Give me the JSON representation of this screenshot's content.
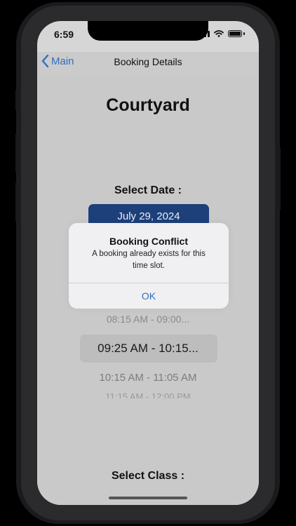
{
  "status_bar": {
    "time": "6:59"
  },
  "nav": {
    "back_label": "Main",
    "title": "Booking Details"
  },
  "venue": {
    "name": "Courtyard"
  },
  "date": {
    "label": "Select Date :",
    "value": "July 29, 2024"
  },
  "time_slots": [
    {
      "text": "08:15 AM - 09:00...",
      "selected": false
    },
    {
      "text": "09:25 AM - 10:15...",
      "selected": true
    },
    {
      "text": "10:15 AM - 11:05 AM",
      "selected": false
    },
    {
      "text": "11:15 AM - 12:00 PM",
      "selected": false
    }
  ],
  "class": {
    "label": "Select Class :"
  },
  "alert": {
    "title": "Booking Conflict",
    "message": "A booking already exists for this time slot.",
    "ok_label": "OK"
  },
  "colors": {
    "accent": "#2f6fbf",
    "date_button": "#1d3f7a"
  }
}
